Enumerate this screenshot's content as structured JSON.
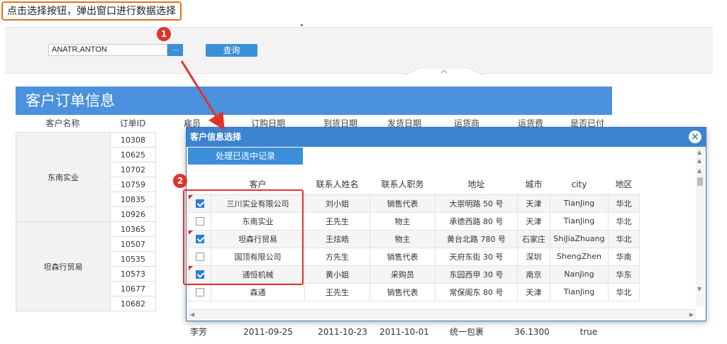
{
  "instruction": "点击选择按钮，弹出窗口进行数据选择",
  "search": {
    "value": "ANATR,ANTON",
    "ellipsis_label": "...",
    "query_label": "查询"
  },
  "badges": [
    "1",
    "2"
  ],
  "report": {
    "title": "客户订单信息",
    "columns": [
      "客户名称",
      "订单ID",
      "雇员",
      "订购日期",
      "到货日期",
      "发货日期",
      "运货商",
      "运货费",
      "是否已付"
    ],
    "groups": [
      {
        "name": "东南实业",
        "ids": [
          "10308",
          "10625",
          "10702",
          "10759",
          "10835",
          "10926"
        ]
      },
      {
        "name": "坦森行贸易",
        "ids": [
          "10365",
          "10507",
          "10535",
          "10573",
          "10677"
        ]
      }
    ],
    "last_row": [
      "10682",
      "李芳",
      "2011-09-25",
      "2011-10-23",
      "2011-10-01",
      "统一包裹",
      "36.1300",
      "true"
    ]
  },
  "dialog": {
    "title": "客户信息选择",
    "process_label": "处理已选中记录",
    "headers": [
      "客户",
      "联系人姓名",
      "联系人职务",
      "地址",
      "城市",
      "city",
      "地区"
    ],
    "rows": [
      {
        "checked": true,
        "cells": [
          "三川实业有限公司",
          "刘小姐",
          "销售代表",
          "大崇明路 50 号",
          "天津",
          "TianJing",
          "华北"
        ]
      },
      {
        "checked": false,
        "cells": [
          "东南实业",
          "王先生",
          "物主",
          "承德西路 80 号",
          "天津",
          "TianJing",
          "华北"
        ]
      },
      {
        "checked": true,
        "cells": [
          "坦森行贸易",
          "王炫皓",
          "物主",
          "黄台北路 780 号",
          "石家庄",
          "ShiJiaZhuang",
          "华北"
        ]
      },
      {
        "checked": false,
        "cells": [
          "国顶有限公司",
          "方先生",
          "销售代表",
          "天府东街 30 号",
          "深圳",
          "ShengZhen",
          "华南"
        ]
      },
      {
        "checked": true,
        "cells": [
          "通恒机械",
          "黄小姐",
          "采购员",
          "东园西甲 30 号",
          "南京",
          "NanJing",
          "华东"
        ]
      },
      {
        "checked": false,
        "cells": [
          "森通",
          "王先生",
          "销售代表",
          "常保阁东 80 号",
          "天津",
          "TianJing",
          "华北"
        ]
      }
    ]
  },
  "colors": {
    "accent": "#3b8fd9",
    "header": "#4b91dd",
    "badge": "#e0342a"
  }
}
